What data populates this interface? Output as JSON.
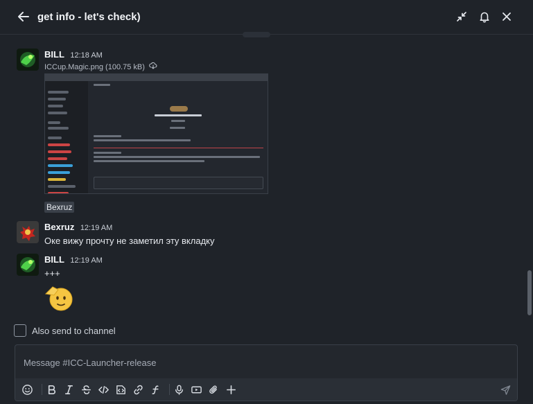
{
  "header": {
    "title": "get info - let's check)"
  },
  "messages": [
    {
      "author": "BILL",
      "time": "12:18 AM",
      "file": {
        "name": "ICCup.Magic.png (100.75 kB)"
      },
      "reaction_chip": "Bexruz"
    },
    {
      "author": "Bexruz",
      "time": "12:19 AM",
      "text": "Оке вижу прочту не заметил эту вкладку"
    },
    {
      "author": "BILL",
      "time": "12:19 AM",
      "text": "+++",
      "emoji": "saluting-face"
    }
  ],
  "also_send": {
    "label": "Also send to channel",
    "checked": false
  },
  "composer": {
    "placeholder": "Message #ICC-Launcher-release",
    "value": ""
  },
  "colors": {
    "background": "#1f2329",
    "accent_red": "#c0444a"
  }
}
